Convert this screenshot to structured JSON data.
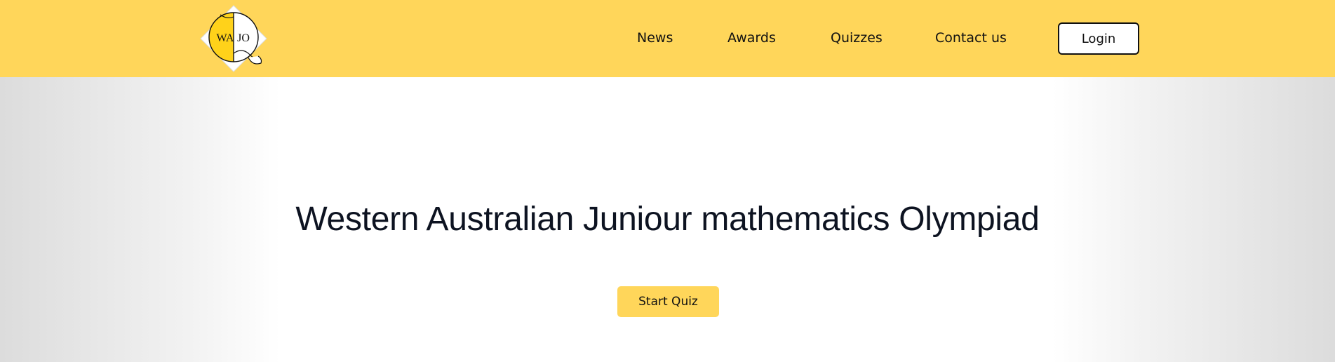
{
  "logo": {
    "left_text": "WA",
    "right_text": "JO"
  },
  "nav": {
    "items": [
      {
        "label": "News"
      },
      {
        "label": "Awards"
      },
      {
        "label": "Quizzes"
      },
      {
        "label": "Contact us"
      }
    ],
    "login_label": "Login"
  },
  "hero": {
    "title": "Western Australian Juniour mathematics Olympiad",
    "cta_label": "Start Quiz"
  },
  "colors": {
    "brand_yellow": "#FFD65A",
    "text_dark": "#0d1321"
  }
}
